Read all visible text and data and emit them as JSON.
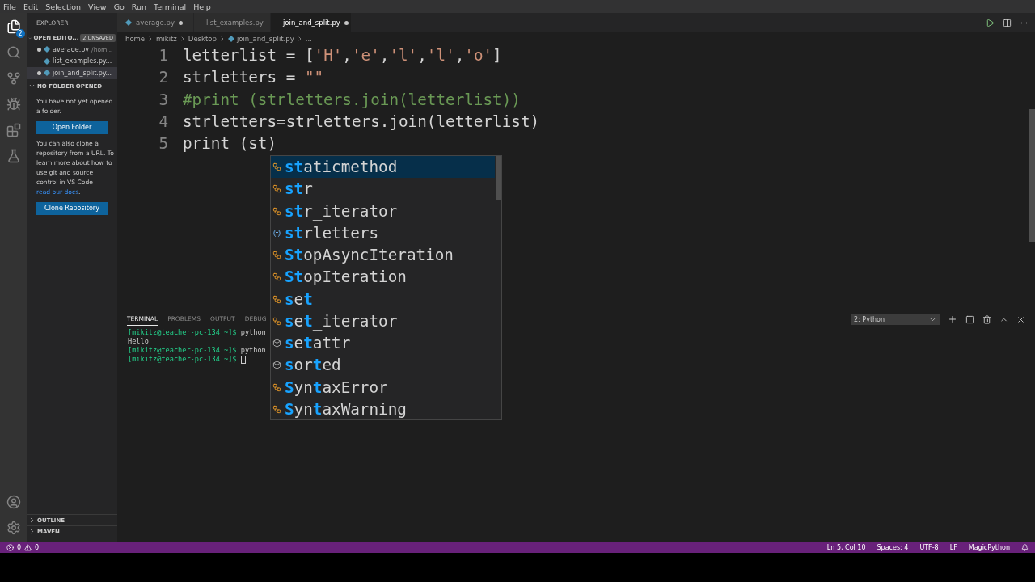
{
  "menu_bar": [
    "File",
    "Edit",
    "Selection",
    "View",
    "Go",
    "Run",
    "Terminal",
    "Help"
  ],
  "activity_bar": {
    "explorer_badge": "2"
  },
  "sidebar": {
    "title": "EXPLORER",
    "more": "···",
    "open_editors": {
      "title": "OPEN EDITO...",
      "badge": "2 UNSAVED",
      "expanded": true,
      "items": [
        {
          "name": "average.py",
          "detail": "/hom...",
          "dirty": true,
          "selected": false
        },
        {
          "name": "list_examples.py...",
          "dirty": false,
          "selected": false
        },
        {
          "name": "join_and_split.py...",
          "dirty": true,
          "selected": true
        }
      ]
    },
    "folder": {
      "title": "NO FOLDER OPENED",
      "expanded": true,
      "message": "You have not yet opened a folder.",
      "open_button": "Open Folder",
      "clone_text": "You can also clone a repository from a URL. To learn more about how to use git and source control in VS Code ",
      "link": "read our docs",
      "after_link": ".",
      "clone_button": "Clone Repository"
    },
    "bottom_sections": [
      {
        "title": "OUTLINE",
        "expanded": false
      },
      {
        "title": "MAVEN",
        "expanded": false
      }
    ]
  },
  "tabs": [
    {
      "label": "average.py",
      "dirty": true,
      "selected": false
    },
    {
      "label": "list_examples.py",
      "dirty": false,
      "selected": false
    },
    {
      "label": "join_and_split.py",
      "dirty": true,
      "selected": true
    }
  ],
  "breadcrumbs": [
    "home",
    "mikitz",
    "Desktop",
    "join_and_split.py",
    "..."
  ],
  "code_lines": [
    {
      "number": "1",
      "tokens": [
        {
          "text": "letterlist = [",
          "kind": "plain"
        },
        {
          "text": "'H'",
          "kind": "string"
        },
        {
          "text": ",",
          "kind": "plain"
        },
        {
          "text": "'e'",
          "kind": "string"
        },
        {
          "text": ",",
          "kind": "plain"
        },
        {
          "text": "'l'",
          "kind": "string"
        },
        {
          "text": ",",
          "kind": "plain"
        },
        {
          "text": "'l'",
          "kind": "string"
        },
        {
          "text": ",",
          "kind": "plain"
        },
        {
          "text": "'o'",
          "kind": "string"
        },
        {
          "text": "]",
          "kind": "plain"
        }
      ]
    },
    {
      "number": "2",
      "tokens": [
        {
          "text": "strletters = ",
          "kind": "plain"
        },
        {
          "text": "\"\"",
          "kind": "string"
        }
      ]
    },
    {
      "number": "3",
      "tokens": [
        {
          "text": "#print (strletters.join(letterlist))",
          "kind": "comment"
        }
      ]
    },
    {
      "number": "4",
      "tokens": [
        {
          "text": "strletters=strletters.join(letterlist)",
          "kind": "plain"
        }
      ]
    },
    {
      "number": "5",
      "tokens": [
        {
          "text": "print (st)",
          "kind": "plain"
        }
      ]
    }
  ],
  "suggestions": [
    {
      "label": "**st**aticmethod",
      "kind": "class",
      "selected": true
    },
    {
      "label": "**st**r",
      "kind": "class",
      "selected": false
    },
    {
      "label": "**st**r_iterator",
      "kind": "class",
      "selected": false
    },
    {
      "label": "**st**rletters",
      "kind": "variable",
      "selected": false
    },
    {
      "label": "**St**opAsyncIteration",
      "kind": "class",
      "selected": false
    },
    {
      "label": "**St**opIteration",
      "kind": "class",
      "selected": false
    },
    {
      "label": "**s**e**t**",
      "kind": "class",
      "selected": false
    },
    {
      "label": "**s**e**t**_iterator",
      "kind": "class",
      "selected": false
    },
    {
      "label": "**s**e**t**attr",
      "kind": "function",
      "selected": false
    },
    {
      "label": "**s**or**t**ed",
      "kind": "function",
      "selected": false
    },
    {
      "label": "**S**yn**t**axError",
      "kind": "class",
      "selected": false
    },
    {
      "label": "**S**yn**t**axWarning",
      "kind": "class",
      "selected": false
    }
  ],
  "panel": {
    "tabs": [
      {
        "label": "TERMINAL",
        "selected": true
      },
      {
        "label": "PROBLEMS",
        "selected": false
      },
      {
        "label": "OUTPUT",
        "selected": false
      },
      {
        "label": "DEBUG",
        "selected": false
      }
    ],
    "terminal_select": "2: Python",
    "lines": [
      {
        "prompt": "[mikitz@teacher-pc-134 ~]$",
        "text": " python"
      },
      {
        "text": "Hello"
      },
      {
        "prompt": "[mikitz@teacher-pc-134 ~]$",
        "text": " python"
      },
      {
        "prompt": "[mikitz@teacher-pc-134 ~]$",
        "cursor": true
      }
    ]
  },
  "status_bar": {
    "errors": "0",
    "warnings": "0",
    "items": [
      "Ln 5, Col 10",
      "Spaces: 4",
      "UTF-8",
      "LF",
      "MagicPython"
    ]
  }
}
